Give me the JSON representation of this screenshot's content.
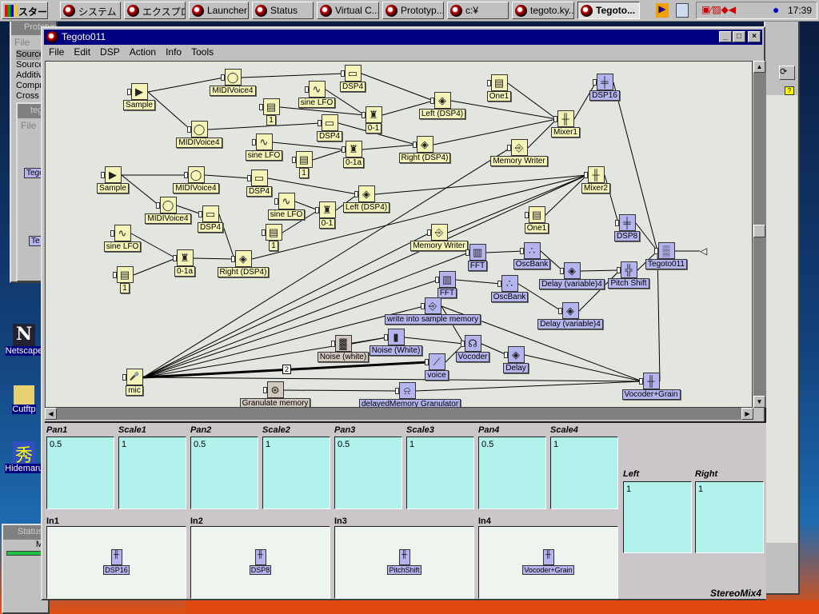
{
  "taskbar": {
    "start": "スタート",
    "items": [
      "システム ...",
      "エクスプロ...",
      "Launcher",
      "Status",
      "Virtual C...",
      "Prototyp...",
      "c:¥",
      "tegoto.ky...",
      "Tegoto..."
    ],
    "active_index": 8,
    "clock": "17:39"
  },
  "background_windows": {
    "prototype": {
      "title": "Prototype",
      "menu": "File",
      "items": [
        "Source",
        "Source",
        "Additive",
        "Compr",
        "Cross"
      ]
    },
    "tegoto_small": {
      "title": "tegoto",
      "menu": "File",
      "nodes": [
        "Tegoto",
        "Te"
      ]
    },
    "status": {
      "title": "Status",
      "text": "M"
    }
  },
  "desktop_icons": [
    "Netscape",
    "Cutftp",
    "Hidemaru"
  ],
  "window": {
    "title": "Tegoto011",
    "menu": [
      "File",
      "Edit",
      "DSP",
      "Action",
      "Info",
      "Tools"
    ]
  },
  "graph": {
    "nodes": [
      {
        "id": "sample1",
        "label": "Sample",
        "kind": "sample",
        "color": "yellow"
      },
      {
        "id": "midi1a",
        "label": "MIDIVoice4",
        "kind": "midi",
        "color": "yellow"
      },
      {
        "id": "midi1b",
        "label": "MIDIVoice4",
        "kind": "midi",
        "color": "yellow"
      },
      {
        "id": "dsp4a",
        "label": "DSP4",
        "kind": "dsp",
        "color": "yellow"
      },
      {
        "id": "sineA",
        "label": "sine LFO",
        "kind": "sine",
        "color": "yellow"
      },
      {
        "id": "oneA",
        "label": "1",
        "kind": "const",
        "color": "yellow"
      },
      {
        "id": "zeroA",
        "label": "0-1",
        "kind": "scale",
        "color": "yellow"
      },
      {
        "id": "dsp4b",
        "label": "DSP4",
        "kind": "dsp",
        "color": "yellow"
      },
      {
        "id": "sineB",
        "label": "sine LFO",
        "kind": "sine",
        "color": "yellow"
      },
      {
        "id": "oneB",
        "label": "1",
        "kind": "const",
        "color": "yellow"
      },
      {
        "id": "zeroB",
        "label": "0-1a",
        "kind": "scale",
        "color": "yellow"
      },
      {
        "id": "leftA",
        "label": "Left (DSP4)",
        "kind": "pan",
        "color": "yellow"
      },
      {
        "id": "rightA",
        "label": "Right (DSP4)",
        "kind": "pan",
        "color": "yellow"
      },
      {
        "id": "one1a",
        "label": "One1",
        "kind": "const",
        "color": "yellow"
      },
      {
        "id": "memwA",
        "label": "Memory Writer",
        "kind": "memw",
        "color": "yellow"
      },
      {
        "id": "mixer1",
        "label": "Mixer1",
        "kind": "mixer",
        "color": "yellow"
      },
      {
        "id": "sample2",
        "label": "Sample",
        "kind": "sample",
        "color": "yellow"
      },
      {
        "id": "midi2a",
        "label": "MIDIVoice4",
        "kind": "midi",
        "color": "yellow"
      },
      {
        "id": "midi2b",
        "label": "MIDIVoice4",
        "kind": "midi",
        "color": "yellow"
      },
      {
        "id": "dsp4c",
        "label": "DSP4",
        "kind": "dsp",
        "color": "yellow"
      },
      {
        "id": "dsp4d",
        "label": "DSP4",
        "kind": "dsp",
        "color": "yellow"
      },
      {
        "id": "sineC",
        "label": "sine LFO",
        "kind": "sine",
        "color": "yellow"
      },
      {
        "id": "oneC",
        "label": "1",
        "kind": "const",
        "color": "yellow"
      },
      {
        "id": "zeroC",
        "label": "0-1",
        "kind": "scale",
        "color": "yellow"
      },
      {
        "id": "leftB",
        "label": "Left (DSP4)",
        "kind": "pan",
        "color": "yellow"
      },
      {
        "id": "sineD",
        "label": "sine LFO",
        "kind": "sine",
        "color": "yellow"
      },
      {
        "id": "oneD",
        "label": "1",
        "kind": "const",
        "color": "yellow"
      },
      {
        "id": "zeroD",
        "label": "0-1a",
        "kind": "scale",
        "color": "yellow"
      },
      {
        "id": "rightB",
        "label": "Right (DSP4)",
        "kind": "pan",
        "color": "yellow"
      },
      {
        "id": "one1b",
        "label": "One1",
        "kind": "const",
        "color": "yellow"
      },
      {
        "id": "memwB",
        "label": "Memory Writer",
        "kind": "memw",
        "color": "yellow"
      },
      {
        "id": "mixer2",
        "label": "Mixer2",
        "kind": "mixer",
        "color": "yellow"
      },
      {
        "id": "mic",
        "label": "mic",
        "kind": "mic",
        "color": "yellow"
      },
      {
        "id": "dsp16",
        "label": "DSP16",
        "kind": "dspn",
        "color": "blue"
      },
      {
        "id": "dsp8",
        "label": "DSP8",
        "kind": "dspn",
        "color": "blue"
      },
      {
        "id": "tegoto",
        "label": "Tegoto011",
        "kind": "out",
        "color": "blue"
      },
      {
        "id": "fftA",
        "label": "FFT",
        "kind": "fft",
        "color": "blue"
      },
      {
        "id": "oscA",
        "label": "OscBank",
        "kind": "osc",
        "color": "blue"
      },
      {
        "id": "delayVarA",
        "label": "Delay (variable)4",
        "kind": "pan",
        "color": "blue"
      },
      {
        "id": "pitch",
        "label": "Pitch Shift",
        "kind": "pitch",
        "color": "blue"
      },
      {
        "id": "fftB",
        "label": "FFT",
        "kind": "fft",
        "color": "blue"
      },
      {
        "id": "oscB",
        "label": "OscBank",
        "kind": "osc",
        "color": "blue"
      },
      {
        "id": "delayVarB",
        "label": "Delay (variable)4",
        "kind": "pan",
        "color": "blue"
      },
      {
        "id": "writeSample",
        "label": "write into sample memory",
        "kind": "memw",
        "color": "blue"
      },
      {
        "id": "noiseW",
        "label": "Noise (White)",
        "kind": "noisef",
        "color": "blue"
      },
      {
        "id": "vocoder",
        "label": "Vocoder",
        "kind": "vocoder",
        "color": "blue"
      },
      {
        "id": "delay",
        "label": "Delay",
        "kind": "pan",
        "color": "blue"
      },
      {
        "id": "voice",
        "label": "voice",
        "kind": "voice",
        "color": "blue"
      },
      {
        "id": "vocGrain",
        "label": "Vocoder+Grain",
        "kind": "mixer",
        "color": "blue"
      },
      {
        "id": "delayedMem",
        "label": "delayedMemory Granulator",
        "kind": "gran",
        "color": "blue"
      },
      {
        "id": "noiseWhite",
        "label": "Noise (white)",
        "kind": "noise",
        "color": "tan"
      },
      {
        "id": "granulate",
        "label": "Granulate memory",
        "kind": "granm",
        "color": "tan"
      }
    ],
    "edges": [
      [
        "sample1",
        "midi1a"
      ],
      [
        "sample1",
        "midi1b"
      ],
      [
        "midi1a",
        "dsp4a"
      ],
      [
        "midi1b",
        "dsp4b"
      ],
      [
        "sineA",
        "zeroA"
      ],
      [
        "oneA",
        "zeroA"
      ],
      [
        "sineB",
        "zeroB"
      ],
      [
        "oneB",
        "zeroB"
      ],
      [
        "dsp4a",
        "leftA"
      ],
      [
        "zeroA",
        "leftA"
      ],
      [
        "dsp4b",
        "rightA"
      ],
      [
        "zeroB",
        "rightA"
      ],
      [
        "leftA",
        "mixer1"
      ],
      [
        "rightA",
        "mixer1"
      ],
      [
        "one1a",
        "mixer1"
      ],
      [
        "memwA",
        "mixer1"
      ],
      [
        "mixer1",
        "dsp16"
      ],
      [
        "dsp16",
        "tegoto"
      ],
      [
        "sample2",
        "midi2a"
      ],
      [
        "sample2",
        "midi2b"
      ],
      [
        "midi2a",
        "dsp4c"
      ],
      [
        "midi2b",
        "dsp4d"
      ],
      [
        "dsp4c",
        "leftB"
      ],
      [
        "sineC",
        "zeroC"
      ],
      [
        "oneC",
        "zeroC"
      ],
      [
        "zeroC",
        "leftB"
      ],
      [
        "sineD",
        "zeroD"
      ],
      [
        "oneD",
        "zeroD"
      ],
      [
        "zeroD",
        "rightB"
      ],
      [
        "dsp4d",
        "rightB"
      ],
      [
        "leftB",
        "mixer2"
      ],
      [
        "rightB",
        "mixer2"
      ],
      [
        "one1b",
        "mixer2"
      ],
      [
        "memwB",
        "mixer2"
      ],
      [
        "mixer2",
        "dsp8"
      ],
      [
        "dsp8",
        "tegoto"
      ],
      [
        "pitch",
        "tegoto"
      ],
      [
        "fftA",
        "oscA"
      ],
      [
        "oscA",
        "delayVarA"
      ],
      [
        "delayVarA",
        "pitch"
      ],
      [
        "fftB",
        "oscB"
      ],
      [
        "oscB",
        "delayVarB"
      ],
      [
        "delayVarB",
        "pitch"
      ],
      [
        "mic",
        "memwA"
      ],
      [
        "mic",
        "memwB"
      ],
      [
        "mic",
        "mixer2"
      ],
      [
        "mic",
        "fftA"
      ],
      [
        "mic",
        "fftB"
      ],
      [
        "mic",
        "writeSample"
      ],
      [
        "mic",
        "noiseW"
      ],
      [
        "mic",
        "vocGrain"
      ],
      [
        "noiseWhite",
        "noiseW"
      ],
      [
        "noiseW",
        "vocoder"
      ],
      [
        "voice",
        "vocoder"
      ],
      [
        "vocoder",
        "delay"
      ],
      [
        "delay",
        "vocGrain"
      ],
      [
        "writeSample",
        "vocGrain"
      ],
      [
        "writeSample",
        "vocoder"
      ],
      [
        "granulate",
        "delayedMem"
      ],
      [
        "delayedMem",
        "vocGrain"
      ],
      [
        "vocGrain",
        "tegoto"
      ]
    ],
    "thick_edge": {
      "from": "mic",
      "to": "voice",
      "label": "2"
    }
  },
  "panel": {
    "title": "StereoMix4",
    "params": [
      {
        "label": "Pan1",
        "value": "0.5"
      },
      {
        "label": "Scale1",
        "value": "1"
      },
      {
        "label": "Pan2",
        "value": "0.5"
      },
      {
        "label": "Scale2",
        "value": "1"
      },
      {
        "label": "Pan3",
        "value": "0.5"
      },
      {
        "label": "Scale3",
        "value": "1"
      },
      {
        "label": "Pan4",
        "value": "0.5"
      },
      {
        "label": "Scale4",
        "value": "1"
      }
    ],
    "inputs": [
      {
        "label": "In1",
        "node": "DSP16"
      },
      {
        "label": "In2",
        "node": "DSP8"
      },
      {
        "label": "In3",
        "node": "PitchShift"
      },
      {
        "label": "In4",
        "node": "Vocoder+Grain"
      }
    ],
    "outputs": [
      {
        "label": "Left",
        "value": "1"
      },
      {
        "label": "Right",
        "value": "1"
      }
    ]
  }
}
